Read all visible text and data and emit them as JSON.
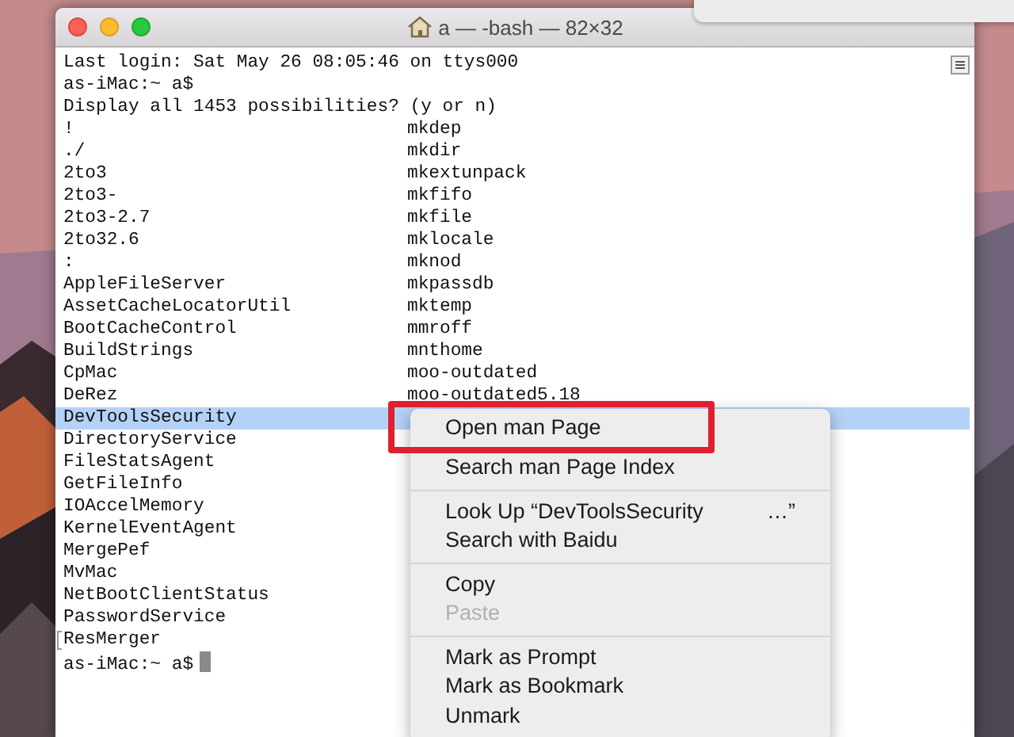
{
  "window": {
    "title": "a — -bash — 82×32"
  },
  "terminal": {
    "lines": [
      "Last login: Sat May 26 08:05:46 on ttys000",
      "as-iMac:~ a$",
      "Display all 1453 possibilities? (y or n)"
    ],
    "completions": [
      {
        "left": "!",
        "right": "mkdep",
        "selected": false,
        "marked": false
      },
      {
        "left": "./",
        "right": "mkdir",
        "selected": false,
        "marked": false
      },
      {
        "left": "2to3",
        "right": "mkextunpack",
        "selected": false,
        "marked": false
      },
      {
        "left": "2to3-",
        "right": "mkfifo",
        "selected": false,
        "marked": false
      },
      {
        "left": "2to3-2.7",
        "right": "mkfile",
        "selected": false,
        "marked": false
      },
      {
        "left": "2to32.6",
        "right": "mklocale",
        "selected": false,
        "marked": false
      },
      {
        "left": ":",
        "right": "mknod",
        "selected": false,
        "marked": false
      },
      {
        "left": "AppleFileServer",
        "right": "mkpassdb",
        "selected": false,
        "marked": false
      },
      {
        "left": "AssetCacheLocatorUtil",
        "right": "mktemp",
        "selected": false,
        "marked": false
      },
      {
        "left": "BootCacheControl",
        "right": "mmroff",
        "selected": false,
        "marked": false
      },
      {
        "left": "BuildStrings",
        "right": "mnthome",
        "selected": false,
        "marked": false
      },
      {
        "left": "CpMac",
        "right": "moo-outdated",
        "selected": false,
        "marked": false
      },
      {
        "left": "DeRez",
        "right": "moo-outdated5.18",
        "selected": false,
        "marked": false
      },
      {
        "left": "DevToolsSecurity",
        "selected": true,
        "marked": false
      },
      {
        "left": "DirectoryService",
        "selected": false,
        "marked": false
      },
      {
        "left": "FileStatsAgent",
        "selected": false,
        "marked": false
      },
      {
        "left": "GetFileInfo",
        "selected": false,
        "marked": false
      },
      {
        "left": "IOAccelMemory",
        "selected": false,
        "marked": false
      },
      {
        "left": "KernelEventAgent",
        "selected": false,
        "marked": false
      },
      {
        "left": "MergePef",
        "selected": false,
        "marked": false
      },
      {
        "left": "MvMac",
        "selected": false,
        "marked": false
      },
      {
        "left": "NetBootClientStatus",
        "selected": false,
        "marked": false
      },
      {
        "left": "PasswordService",
        "selected": false,
        "marked": false
      },
      {
        "left": "ResMerger",
        "selected": false,
        "marked": true
      }
    ],
    "prompt": "as-iMac:~ a$"
  },
  "context_menu": [
    {
      "kind": "item",
      "label": "Open man Page",
      "disabled": false,
      "annotated": true
    },
    {
      "kind": "item",
      "label": "Search man Page Index",
      "disabled": false,
      "annotated": false
    },
    {
      "kind": "separator"
    },
    {
      "kind": "item",
      "label": "Look Up “DevToolsSecurity",
      "suffix": "…”",
      "disabled": false,
      "annotated": false
    },
    {
      "kind": "item",
      "label": "Search with Baidu",
      "disabled": false,
      "annotated": false
    },
    {
      "kind": "separator"
    },
    {
      "kind": "item",
      "label": "Copy",
      "disabled": false,
      "annotated": false
    },
    {
      "kind": "item",
      "label": "Paste",
      "disabled": true,
      "annotated": false
    },
    {
      "kind": "separator"
    },
    {
      "kind": "item",
      "label": "Mark as Prompt",
      "disabled": false,
      "annotated": false
    },
    {
      "kind": "item",
      "label": "Mark as Bookmark",
      "disabled": false,
      "annotated": false
    },
    {
      "kind": "item",
      "label": "Unmark",
      "disabled": false,
      "annotated": false
    }
  ]
}
